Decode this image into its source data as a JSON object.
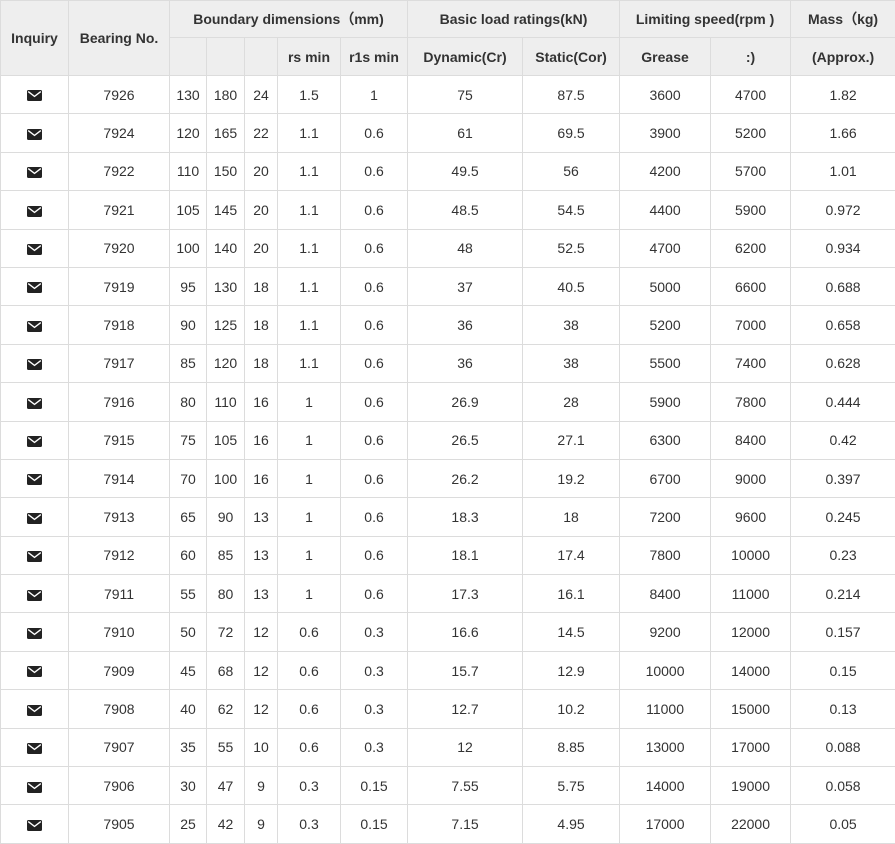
{
  "headers": {
    "inquiry": "Inquiry",
    "bearing_no": "Bearing No.",
    "boundary": "Boundary dimensions（mm)",
    "load": "Basic load ratings(kN)",
    "speed": "Limiting speed(rpm )",
    "mass": "Mass（kg)",
    "sub": {
      "d": "",
      "D": "",
      "B": "",
      "rs_min": "rs min",
      "r1s_min": "r1s min",
      "dynamic": "Dynamic(Cr)",
      "static": "Static(Cor)",
      "grease": "Grease",
      "oil": ":)",
      "approx": "(Approx.)"
    }
  },
  "icons": {
    "inquiry": "envelope-icon"
  },
  "colors": {
    "header_bg": "#eeeeee",
    "border": "#dcdcdc",
    "text": "#333333",
    "icon": "#222222"
  },
  "rows": [
    {
      "no": "7926",
      "d": "130",
      "D": "180",
      "B": "24",
      "rs": "1.5",
      "r1s": "1",
      "cr": "75",
      "cor": "87.5",
      "grease": "3600",
      "oil": "4700",
      "mass": "1.82"
    },
    {
      "no": "7924",
      "d": "120",
      "D": "165",
      "B": "22",
      "rs": "1.1",
      "r1s": "0.6",
      "cr": "61",
      "cor": "69.5",
      "grease": "3900",
      "oil": "5200",
      "mass": "1.66"
    },
    {
      "no": "7922",
      "d": "110",
      "D": "150",
      "B": "20",
      "rs": "1.1",
      "r1s": "0.6",
      "cr": "49.5",
      "cor": "56",
      "grease": "4200",
      "oil": "5700",
      "mass": "1.01"
    },
    {
      "no": "7921",
      "d": "105",
      "D": "145",
      "B": "20",
      "rs": "1.1",
      "r1s": "0.6",
      "cr": "48.5",
      "cor": "54.5",
      "grease": "4400",
      "oil": "5900",
      "mass": "0.972"
    },
    {
      "no": "7920",
      "d": "100",
      "D": "140",
      "B": "20",
      "rs": "1.1",
      "r1s": "0.6",
      "cr": "48",
      "cor": "52.5",
      "grease": "4700",
      "oil": "6200",
      "mass": "0.934"
    },
    {
      "no": "7919",
      "d": "95",
      "D": "130",
      "B": "18",
      "rs": "1.1",
      "r1s": "0.6",
      "cr": "37",
      "cor": "40.5",
      "grease": "5000",
      "oil": "6600",
      "mass": "0.688"
    },
    {
      "no": "7918",
      "d": "90",
      "D": "125",
      "B": "18",
      "rs": "1.1",
      "r1s": "0.6",
      "cr": "36",
      "cor": "38",
      "grease": "5200",
      "oil": "7000",
      "mass": "0.658"
    },
    {
      "no": "7917",
      "d": "85",
      "D": "120",
      "B": "18",
      "rs": "1.1",
      "r1s": "0.6",
      "cr": "36",
      "cor": "38",
      "grease": "5500",
      "oil": "7400",
      "mass": "0.628"
    },
    {
      "no": "7916",
      "d": "80",
      "D": "110",
      "B": "16",
      "rs": "1",
      "r1s": "0.6",
      "cr": "26.9",
      "cor": "28",
      "grease": "5900",
      "oil": "7800",
      "mass": "0.444"
    },
    {
      "no": "7915",
      "d": "75",
      "D": "105",
      "B": "16",
      "rs": "1",
      "r1s": "0.6",
      "cr": "26.5",
      "cor": "27.1",
      "grease": "6300",
      "oil": "8400",
      "mass": "0.42"
    },
    {
      "no": "7914",
      "d": "70",
      "D": "100",
      "B": "16",
      "rs": "1",
      "r1s": "0.6",
      "cr": "26.2",
      "cor": "19.2",
      "grease": "6700",
      "oil": "9000",
      "mass": "0.397"
    },
    {
      "no": "7913",
      "d": "65",
      "D": "90",
      "B": "13",
      "rs": "1",
      "r1s": "0.6",
      "cr": "18.3",
      "cor": "18",
      "grease": "7200",
      "oil": "9600",
      "mass": "0.245"
    },
    {
      "no": "7912",
      "d": "60",
      "D": "85",
      "B": "13",
      "rs": "1",
      "r1s": "0.6",
      "cr": "18.1",
      "cor": "17.4",
      "grease": "7800",
      "oil": "10000",
      "mass": "0.23"
    },
    {
      "no": "7911",
      "d": "55",
      "D": "80",
      "B": "13",
      "rs": "1",
      "r1s": "0.6",
      "cr": "17.3",
      "cor": "16.1",
      "grease": "8400",
      "oil": "11000",
      "mass": "0.214"
    },
    {
      "no": "7910",
      "d": "50",
      "D": "72",
      "B": "12",
      "rs": "0.6",
      "r1s": "0.3",
      "cr": "16.6",
      "cor": "14.5",
      "grease": "9200",
      "oil": "12000",
      "mass": "0.157"
    },
    {
      "no": "7909",
      "d": "45",
      "D": "68",
      "B": "12",
      "rs": "0.6",
      "r1s": "0.3",
      "cr": "15.7",
      "cor": "12.9",
      "grease": "10000",
      "oil": "14000",
      "mass": "0.15"
    },
    {
      "no": "7908",
      "d": "40",
      "D": "62",
      "B": "12",
      "rs": "0.6",
      "r1s": "0.3",
      "cr": "12.7",
      "cor": "10.2",
      "grease": "11000",
      "oil": "15000",
      "mass": "0.13"
    },
    {
      "no": "7907",
      "d": "35",
      "D": "55",
      "B": "10",
      "rs": "0.6",
      "r1s": "0.3",
      "cr": "12",
      "cor": "8.85",
      "grease": "13000",
      "oil": "17000",
      "mass": "0.088"
    },
    {
      "no": "7906",
      "d": "30",
      "D": "47",
      "B": "9",
      "rs": "0.3",
      "r1s": "0.15",
      "cr": "7.55",
      "cor": "5.75",
      "grease": "14000",
      "oil": "19000",
      "mass": "0.058"
    },
    {
      "no": "7905",
      "d": "25",
      "D": "42",
      "B": "9",
      "rs": "0.3",
      "r1s": "0.15",
      "cr": "7.15",
      "cor": "4.95",
      "grease": "17000",
      "oil": "22000",
      "mass": "0.05"
    }
  ]
}
